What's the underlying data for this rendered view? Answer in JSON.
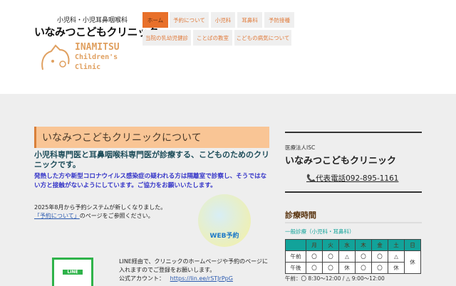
{
  "header": {
    "logo_sub": "小児科・小児耳鼻咽喉科",
    "logo_main": "いなみつこどもクリニック",
    "logo_en": [
      "INAMITSU",
      "Children's",
      "Clinic"
    ]
  },
  "nav": [
    "ホーム",
    "予約について",
    "小児科",
    "耳鼻科",
    "予防接種",
    "当院の乳幼児健診",
    "ことばの教室",
    "こどもの病気について"
  ],
  "main": {
    "heading": "いなみつこどもクリニックについて",
    "subtitle": "小児科専門医と耳鼻咽喉科専門医が診療する、こどものためのクリニックです。",
    "notice": "発熱した方や新型コロナウイルス感染症の疑われる方は隔離室で診察し、そうではない方と接触がないようにしています。ご協力をお願いいたします。",
    "system_text": "2025年8月から予約システムが新しくなりました。",
    "reserve_link": "「予約について」",
    "reserve_suffix": "のページをご参照ください。",
    "web_label": "WEB予約",
    "qr_label": "LINE",
    "line_text": "LINE経由で、クリニックのホームページや予約のページに入れますのでご登録をお願いします。",
    "account_label": "公式アカウント：",
    "account_link": "https://lin.ee/rSTJrPpG"
  },
  "sidebar": {
    "corp": "医療法人ISC",
    "clinic": "いなみつこどもクリニック",
    "phone": "代表電話092-895-1161",
    "hours_title": "診療時間",
    "general": "一般診療（小児科・耳鼻科）",
    "days": [
      "月",
      "火",
      "水",
      "木",
      "金",
      "土",
      "日"
    ],
    "rows": [
      {
        "label": "午前",
        "vals": [
          "〇",
          "〇",
          "△",
          "〇",
          "〇",
          "△"
        ]
      },
      {
        "label": "午後",
        "vals": [
          "〇",
          "〇",
          "休",
          "〇",
          "〇",
          "休"
        ]
      }
    ],
    "sunday": "休",
    "note": "午前：〇 8:30〜12:00 / △ 9:00〜12:00"
  },
  "colors": {
    "accent": "#e8702a",
    "teal": "#12a39a"
  }
}
